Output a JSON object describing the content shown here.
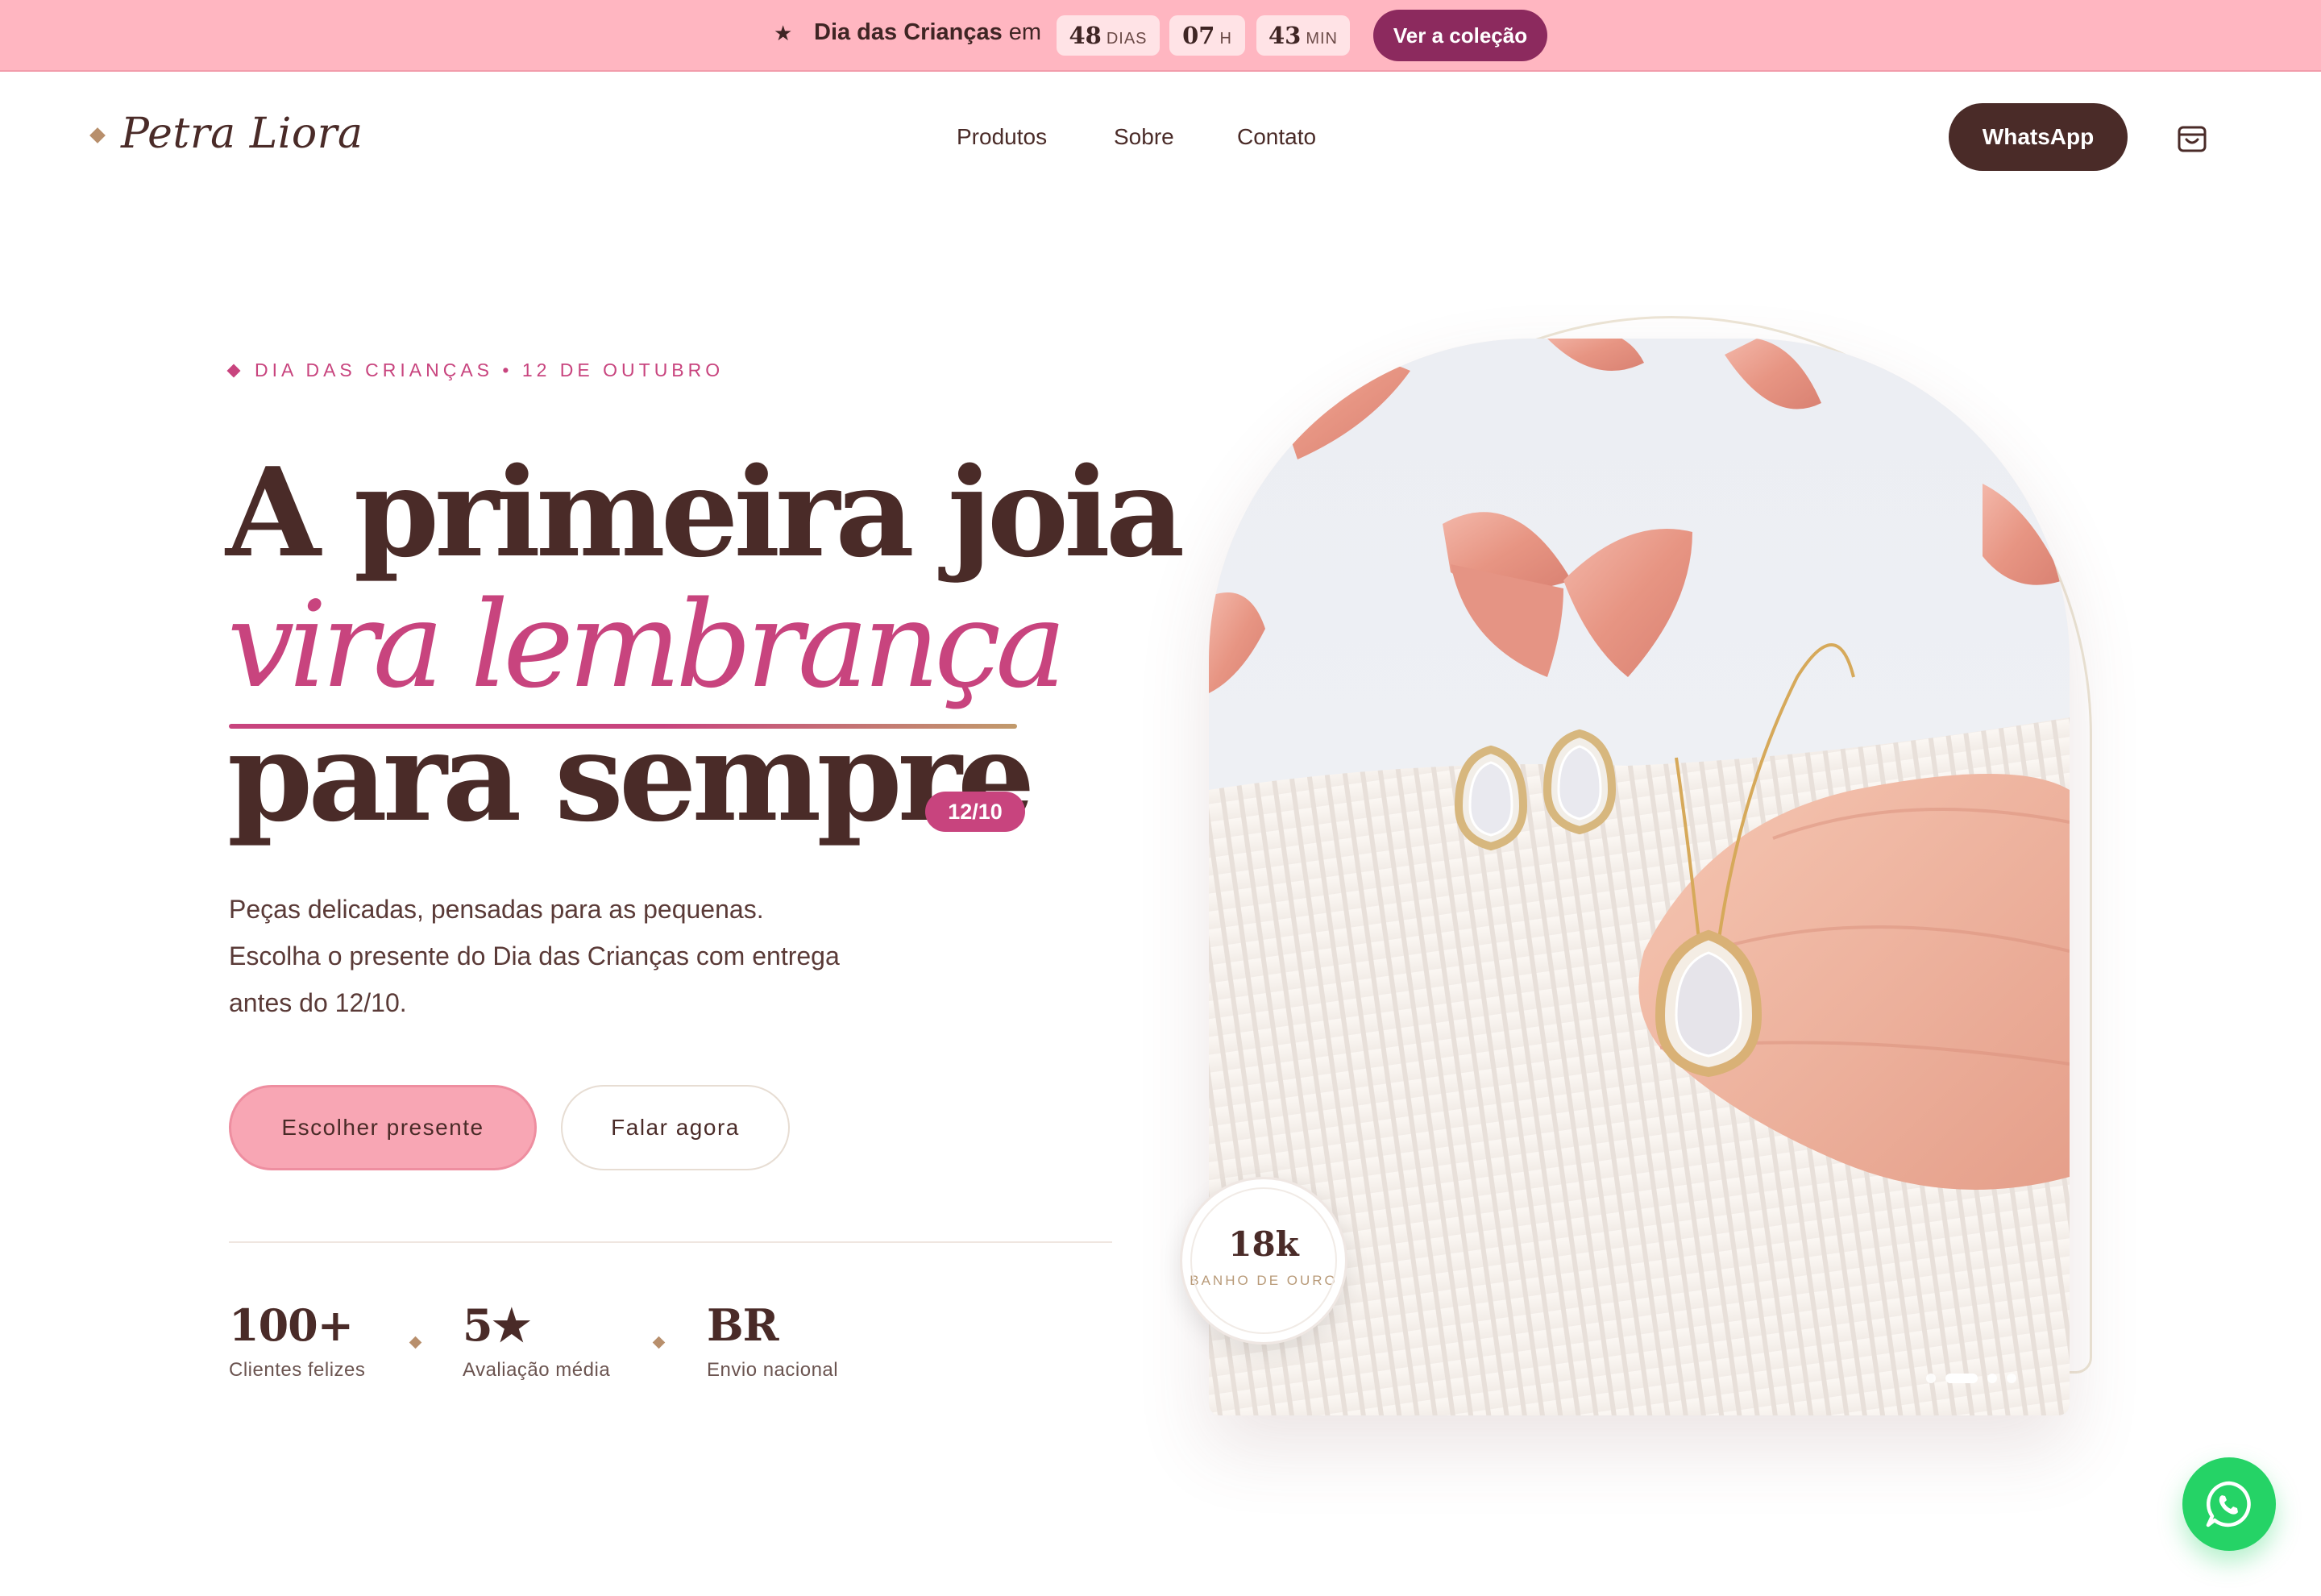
{
  "announcement": {
    "prefix": "Dia das Crianças",
    "suffix": "em",
    "countdown": [
      {
        "value": "48",
        "unit": "DIAS"
      },
      {
        "value": "07",
        "unit": "H"
      },
      {
        "value": "43",
        "unit": "MIN"
      }
    ],
    "cta_label": "Ver a coleção"
  },
  "header": {
    "logo": "Petra Liora",
    "nav": [
      "Produtos",
      "Sobre",
      "Contato"
    ],
    "whatsapp_label": "WhatsApp"
  },
  "hero": {
    "eyebrow": "DIA DAS CRIANÇAS • 12 DE OUTUBRO",
    "headline_line1": "A primeira joia",
    "headline_line2": "vira lembrança",
    "headline_line3": "para sempre",
    "date_badge": "12/10",
    "description_lines": [
      "Peças delicadas, pensadas para as pequenas.",
      "Escolha o presente do Dia das Crianças com entrega",
      "antes do 12/10."
    ],
    "primary_cta": "Escolher presente",
    "secondary_cta": "Falar agora",
    "stats": [
      {
        "value": "100+",
        "label": "Clientes felizes"
      },
      {
        "value": "5★",
        "label": "Avaliação média"
      },
      {
        "value": "BR",
        "label": "Envio nacional"
      }
    ],
    "seal": {
      "value": "18k",
      "label": "BANHO DE OURO"
    },
    "carousel_active_slide": 2,
    "carousel_slide_count": 4
  },
  "colors": {
    "announcement_bg": "#ffb6c1",
    "brand_dark": "#4a2b28",
    "accent_pink": "#c8447e",
    "cta_plum": "#8c2a5e",
    "primary_button": "#f8a6b4",
    "whatsapp_green": "#25d366"
  }
}
